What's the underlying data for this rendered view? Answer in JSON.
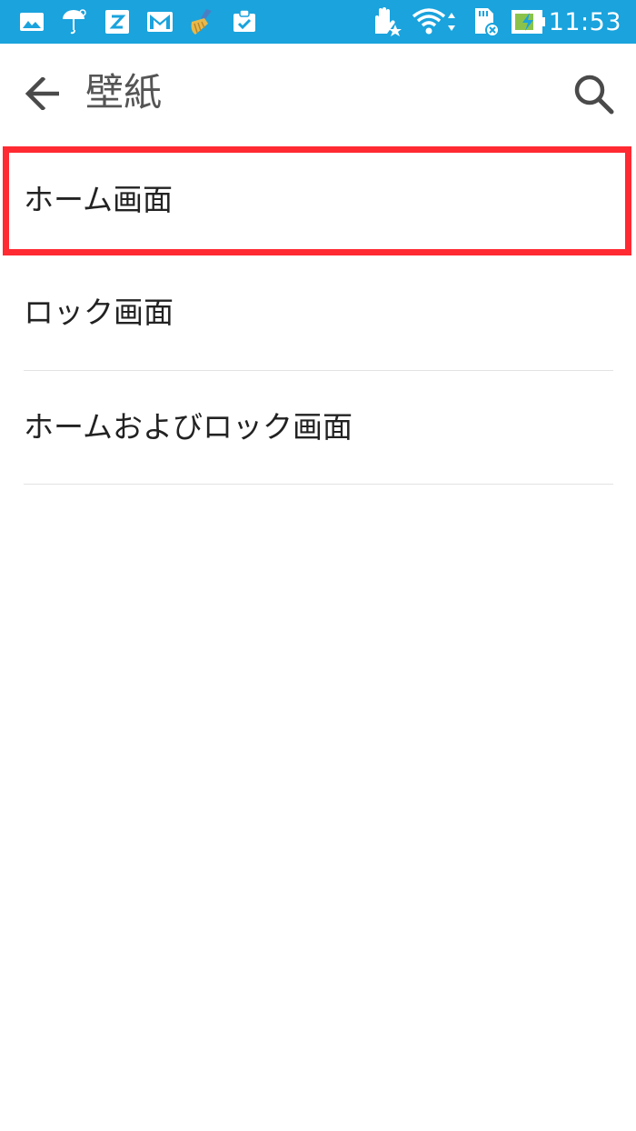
{
  "status_bar": {
    "time": "11:53",
    "icons": [
      "photo-icon",
      "umbrella-icon",
      "z-app-icon",
      "gmail-icon",
      "broom-icon",
      "clipboard-check-icon",
      "hand-star-icon",
      "wifi-icon",
      "sd-card-icon",
      "battery-charging-icon"
    ],
    "background_color": "#1aa3dd"
  },
  "app_bar": {
    "title": "壁紙",
    "back_icon": "arrow-left-icon",
    "search_icon": "search-icon"
  },
  "list": {
    "items": [
      {
        "label": "ホーム画面",
        "highlighted": true
      },
      {
        "label": "ロック画面",
        "highlighted": false
      },
      {
        "label": "ホームおよびロック画面",
        "highlighted": false
      }
    ]
  },
  "colors": {
    "highlight": "#ff2a32",
    "divider": "#e2e2e2",
    "title_text": "#555555",
    "item_text": "#222222"
  }
}
